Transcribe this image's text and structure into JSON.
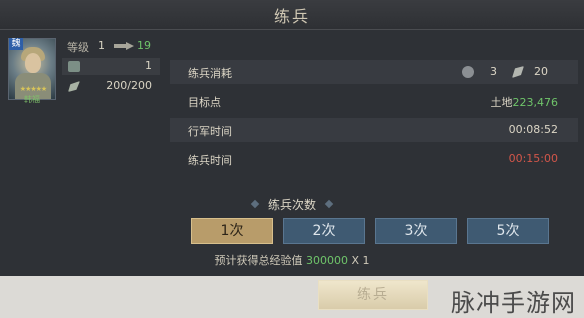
{
  "window": {
    "title": "练兵"
  },
  "hero": {
    "faction": "魏",
    "name": "韩福",
    "stars": "★★★★★"
  },
  "stats": {
    "level_label": "等级",
    "level_current": "1",
    "level_next": "19",
    "troop_value": "1",
    "troop_capacity": "200/200"
  },
  "info": {
    "cost_label": "练兵消耗",
    "cost_a": "3",
    "cost_b": "20",
    "target_label": "目标点",
    "target_prefix": "土地",
    "target_number": "223,476",
    "march_label": "行军时间",
    "march_value": "00:08:52",
    "train_label": "练兵时间",
    "train_value": "00:15:00"
  },
  "training": {
    "count_title": "练兵次数",
    "options": [
      "1次",
      "2次",
      "3次",
      "5次"
    ],
    "selected_index": 0,
    "exp_prefix": "预计获得总经验值",
    "exp_value": "300000",
    "exp_suffix": "X 1"
  },
  "confirm_label": "练兵",
  "watermark": "脉冲手游网",
  "colors": {
    "accent_green": "#6fc46a",
    "time_red": "#d2564a",
    "selected_gold": "#b89c6a",
    "option_blue": "#3f5a72"
  },
  "icons": [
    "arrow-right-icon",
    "troop-icon",
    "flag-icon",
    "stamina-icon"
  ]
}
